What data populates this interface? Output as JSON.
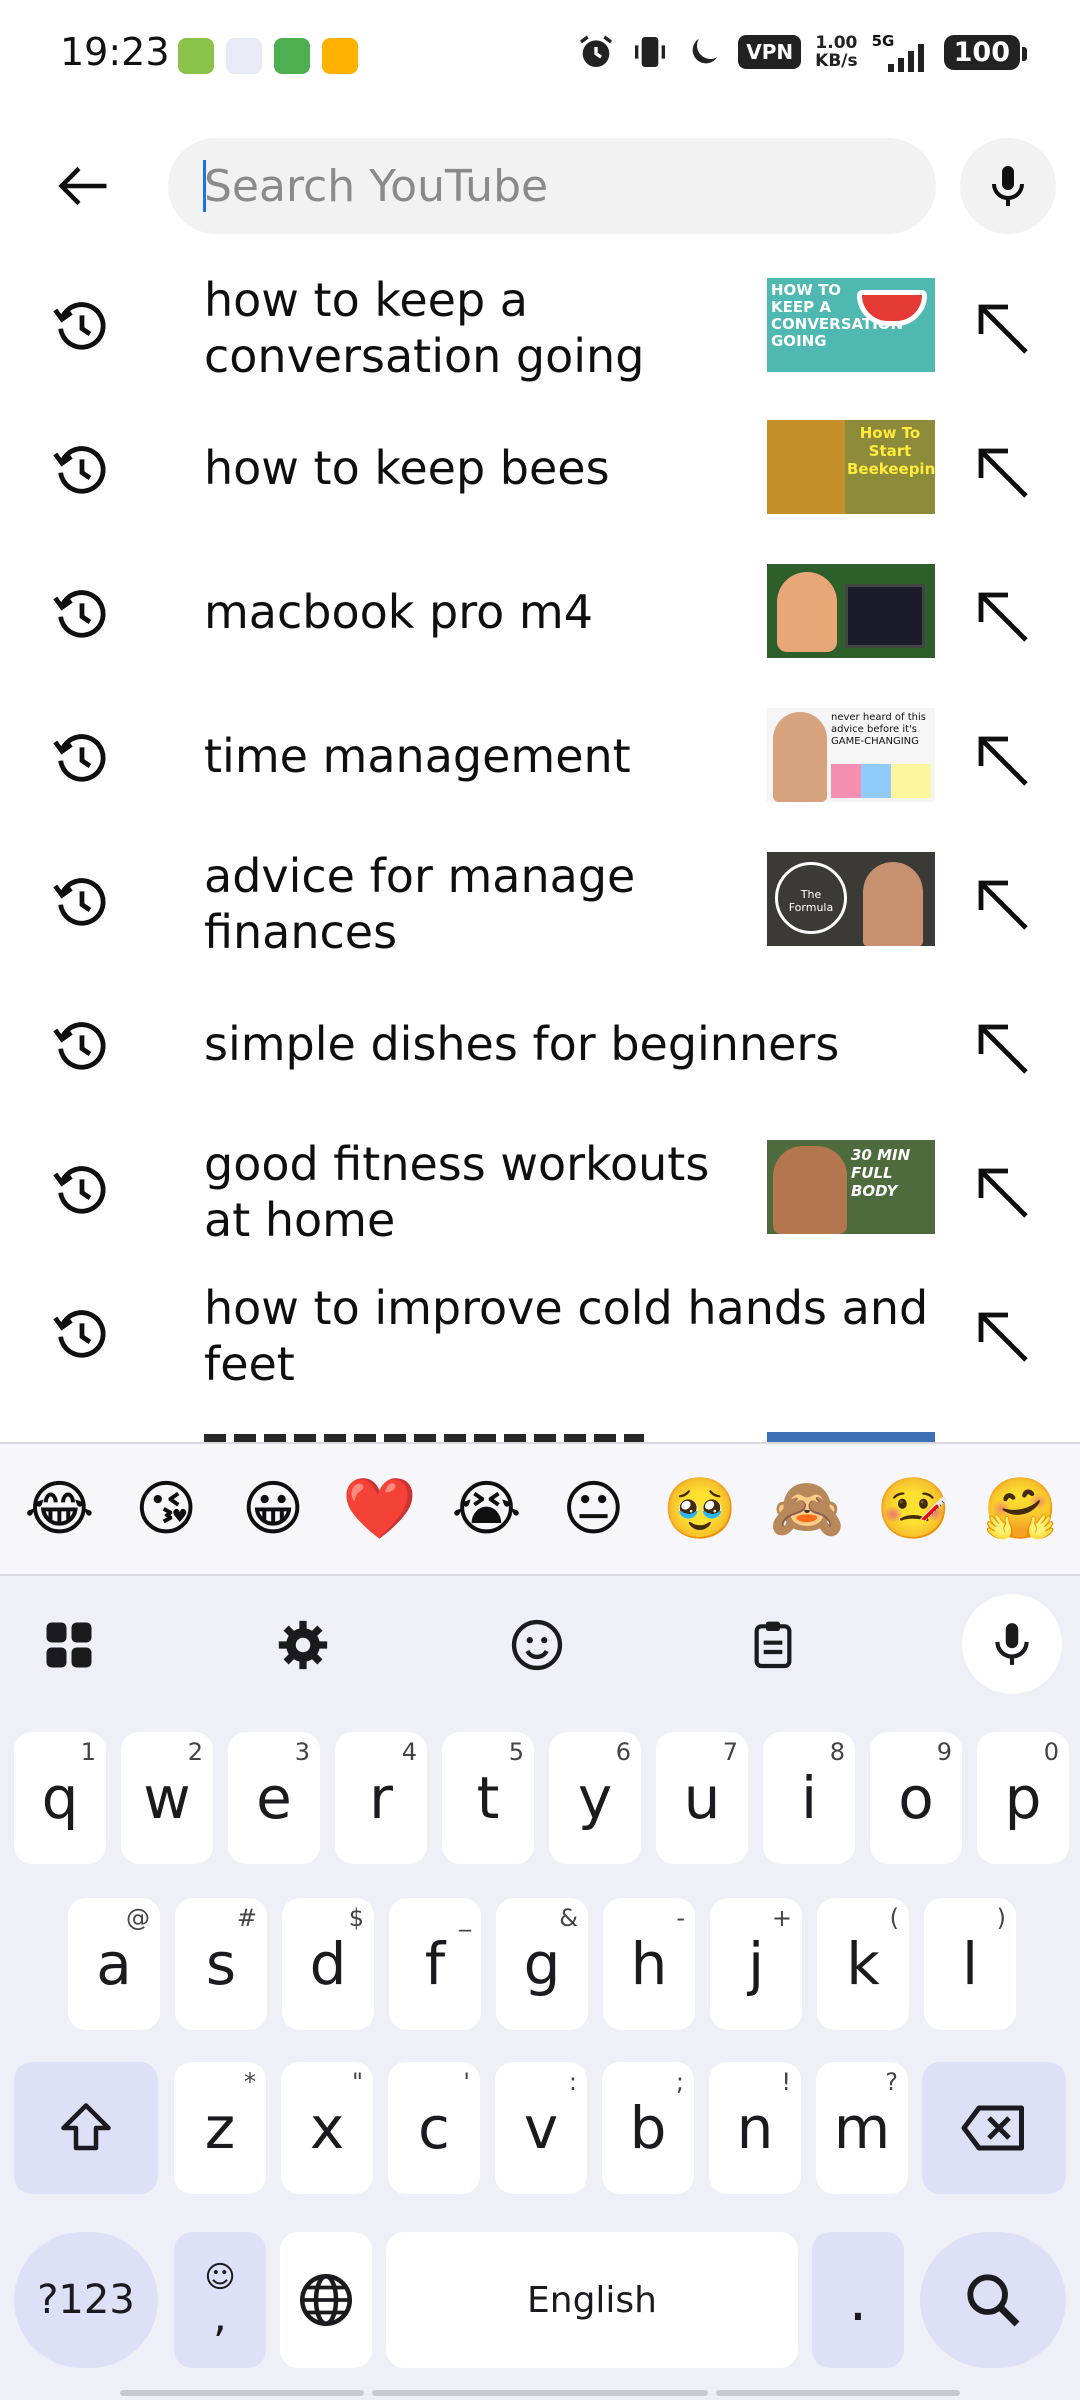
{
  "status_bar": {
    "time": "19:23",
    "vpn": "VPN",
    "net_speed_value": "1.00",
    "net_speed_unit": "KB/s",
    "network": "5G",
    "battery": "100"
  },
  "search": {
    "placeholder": "Search YouTube",
    "value": ""
  },
  "suggestions": [
    {
      "text": "how to keep a conversation going",
      "thumb": "HOW TO KEEP A CONVERSATION GOING"
    },
    {
      "text": "how to keep bees",
      "thumb": "How To Start Beekeeping"
    },
    {
      "text": "macbook pro m4",
      "thumb": ""
    },
    {
      "text": "time management",
      "thumb": "never heard of this advice before it's GAME-CHANGING"
    },
    {
      "text": "advice for manage finances",
      "thumb": "The Formula"
    },
    {
      "text": "simple dishes for beginners",
      "thumb": ""
    },
    {
      "text": "good fitness workouts at home",
      "thumb": "30 MIN FULL BODY"
    },
    {
      "text": "how to improve cold hands and feet",
      "thumb": ""
    }
  ],
  "keyboard": {
    "emojis": [
      "😂",
      "😘",
      "😀",
      "❤️",
      "😭",
      "😐",
      "🥹",
      "🙈",
      "🤒",
      "🤗"
    ],
    "row1": [
      {
        "k": "q",
        "h": "1"
      },
      {
        "k": "w",
        "h": "2"
      },
      {
        "k": "e",
        "h": "3"
      },
      {
        "k": "r",
        "h": "4"
      },
      {
        "k": "t",
        "h": "5"
      },
      {
        "k": "y",
        "h": "6"
      },
      {
        "k": "u",
        "h": "7"
      },
      {
        "k": "i",
        "h": "8"
      },
      {
        "k": "o",
        "h": "9"
      },
      {
        "k": "p",
        "h": "0"
      }
    ],
    "row2": [
      {
        "k": "a",
        "h": "@"
      },
      {
        "k": "s",
        "h": "#"
      },
      {
        "k": "d",
        "h": "$"
      },
      {
        "k": "f",
        "h": "_"
      },
      {
        "k": "g",
        "h": "&"
      },
      {
        "k": "h",
        "h": "-"
      },
      {
        "k": "j",
        "h": "+"
      },
      {
        "k": "k",
        "h": "("
      },
      {
        "k": "l",
        "h": ")"
      }
    ],
    "row3": [
      {
        "k": "z",
        "h": "*"
      },
      {
        "k": "x",
        "h": "\""
      },
      {
        "k": "c",
        "h": "'"
      },
      {
        "k": "v",
        "h": ":"
      },
      {
        "k": "b",
        "h": ";"
      },
      {
        "k": "n",
        "h": "!"
      },
      {
        "k": "m",
        "h": "?"
      }
    ],
    "symbols_label": "?123",
    "comma": ",",
    "space_label": "English",
    "period": "."
  }
}
